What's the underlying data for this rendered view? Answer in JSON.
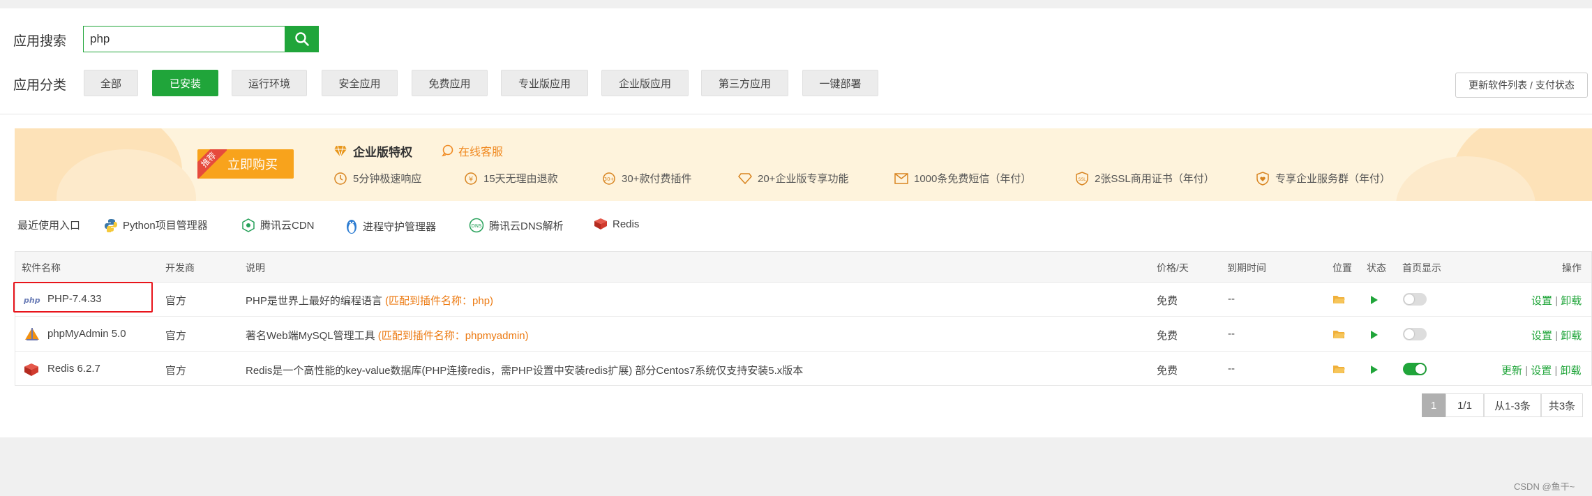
{
  "search": {
    "label": "应用搜索",
    "value": "php"
  },
  "category": {
    "label": "应用分类",
    "items": [
      "全部",
      "已安装",
      "运行环境",
      "安全应用",
      "免费应用",
      "专业版应用",
      "企业版应用",
      "第三方应用",
      "一键部署"
    ],
    "active_index": 1,
    "update_button": "更新软件列表 / 支付状态"
  },
  "banner": {
    "ribbon": "推荐",
    "buy_button": "立即购买",
    "title": "企业版特权",
    "service": "在线客服",
    "features": [
      "5分钟极速响应",
      "15天无理由退款",
      "30+款付费插件",
      "20+企业版专享功能",
      "1000条免费短信（年付）",
      "2张SSL商用证书（年付）",
      "专享企业服务群（年付）"
    ],
    "feature_icons": [
      "clock-icon",
      "refund-icon",
      "plugin-30-icon",
      "diamond-icon",
      "mail-icon",
      "ssl-shield-icon",
      "heart-shield-icon"
    ]
  },
  "recent": {
    "label": "最近使用入口",
    "items": [
      {
        "label": "Python项目管理器",
        "icon": "python-icon"
      },
      {
        "label": "腾讯云CDN",
        "icon": "cdn-icon"
      },
      {
        "label": "进程守护管理器",
        "icon": "penguin-icon"
      },
      {
        "label": "腾讯云DNS解析",
        "icon": "dns-icon"
      },
      {
        "label": "Redis",
        "icon": "redis-icon"
      }
    ]
  },
  "table": {
    "headers": {
      "name": "软件名称",
      "developer": "开发商",
      "description": "说明",
      "price": "价格/天",
      "expire": "到期时间",
      "location": "位置",
      "status": "状态",
      "homepage": "首页显示",
      "action": "操作"
    },
    "rows": [
      {
        "name": "PHP-7.4.33",
        "icon": "php-icon",
        "developer": "官方",
        "description": "PHP是世界上最好的编程语言",
        "match": "(匹配到插件名称：php)",
        "price": "免费",
        "expire": "--",
        "homepage_on": false,
        "actions": [
          "设置",
          "卸载"
        ]
      },
      {
        "name": "phpMyAdmin 5.0",
        "icon": "phpmyadmin-icon",
        "developer": "官方",
        "description": "著名Web端MySQL管理工具",
        "match": "(匹配到插件名称：phpmyadmin)",
        "price": "免费",
        "expire": "--",
        "homepage_on": false,
        "actions": [
          "设置",
          "卸载"
        ]
      },
      {
        "name": "Redis 6.2.7",
        "icon": "redis-icon",
        "developer": "官方",
        "description": "Redis是一个高性能的key-value数据库(PHP连接redis，需PHP设置中安装redis扩展) 部分Centos7系统仅支持安装5.x版本",
        "match": "",
        "price": "免费",
        "expire": "--",
        "homepage_on": true,
        "actions": [
          "更新",
          "设置",
          "卸载"
        ]
      }
    ],
    "action_separator": "|"
  },
  "pagination": {
    "current": "1",
    "pages": "1/1",
    "range": "从1-3条",
    "total": "共3条"
  },
  "footer": "CSDN @鱼干~",
  "colors": {
    "accent": "#20a53a",
    "orange": "#f8a31c",
    "match": "#ec7a12",
    "highlight": "#e8141b"
  }
}
